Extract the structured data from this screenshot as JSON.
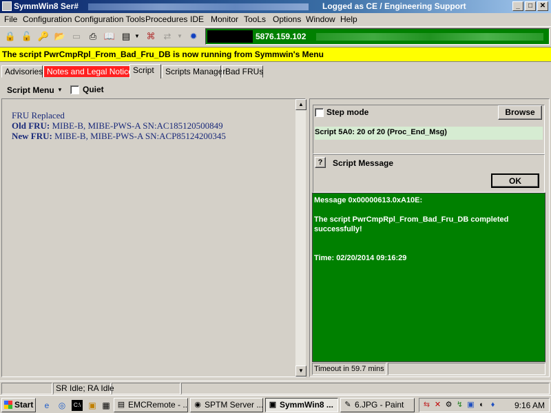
{
  "window": {
    "title_left": "SymmWin8 Ser#",
    "title_right": "Logged as CE / Engineering Support",
    "buttons": [
      "_",
      "□",
      "✕"
    ]
  },
  "menu": [
    "File",
    "Configuration",
    "Configuration Tools",
    "Procedures",
    "IDE",
    "Monitor",
    "TooLs",
    "Options",
    "Window",
    "Help"
  ],
  "toolbar": {
    "server_ip": "5876.159.102",
    "server_bar_color": "#008000"
  },
  "banner": {
    "text": "The script PwrCmpRpl_From_Bad_Fru_DB is now running from Symmwin's Menu",
    "color": "#ffff00"
  },
  "tabs": [
    "Advisories",
    "Notes and Legal Notices",
    "Script",
    "Scripts Manager",
    "Bad FRUs"
  ],
  "script_menu": {
    "label": "Script Menu",
    "quiet_label": "Quiet"
  },
  "script_output": {
    "heading": "FRU Replaced",
    "old_label": "Old FRU:",
    "old_value": "MIBE-B, MIBE-PWS-A SN:AC185120500849",
    "new_label": "New FRU:",
    "new_value": "MIBE-B, MIBE-PWS-A SN:ACP85124200345"
  },
  "step": {
    "step_mode_label": "Step mode",
    "browse_label": "Browse",
    "script_status": "Script 5A0: 20 of 20 (Proc_End_Msg)"
  },
  "message": {
    "help_label": "?",
    "title": "Script Message",
    "ok_label": "OK",
    "line1": "Message 0x00000613.0xA10E:",
    "line2": "The script PwrCmpRpl_From_Bad_Fru_DB completed",
    "line3": "successfully!",
    "line4": "Time: 02/20/2014 09:16:29",
    "bg_color": "#008000"
  },
  "timeout": "Timeout in 59.7 mins",
  "status": {
    "sr_idle": "SR Idle; RA Idle"
  },
  "taskbar": {
    "start_label": "Start",
    "tasks": [
      "EMCRemote - ...",
      "SPTM Server ...",
      "SymmWin8 ...",
      "6.JPG - Paint"
    ],
    "clock": "9:16 AM"
  }
}
